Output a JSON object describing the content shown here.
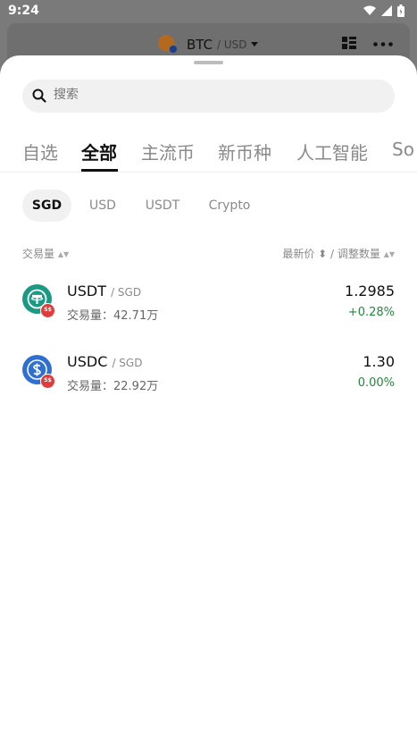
{
  "status_bar": {
    "time": "9:24"
  },
  "header": {
    "base": "BTC",
    "quote": "/ USD"
  },
  "search": {
    "placeholder": "搜索"
  },
  "tabs": [
    {
      "label": "自选"
    },
    {
      "label": "全部"
    },
    {
      "label": "主流币"
    },
    {
      "label": "新币种"
    },
    {
      "label": "人工智能"
    },
    {
      "label": "So"
    }
  ],
  "currencies": [
    {
      "label": "SGD"
    },
    {
      "label": "USD"
    },
    {
      "label": "USDT"
    },
    {
      "label": "Crypto"
    }
  ],
  "columns": {
    "volume": "交易量",
    "price_change": "最新价 ⬍ / 调整数量"
  },
  "rows": [
    {
      "symbol": "USDT",
      "quote": "/ SGD",
      "volume": "交易量：42.71万",
      "price": "1.2985",
      "change": "+0.28%",
      "badge": "S$",
      "color": "#1a9a83"
    },
    {
      "symbol": "USDC",
      "quote": "/ SGD",
      "volume": "交易量：22.92万",
      "price": "1.30",
      "change": "0.00%",
      "badge": "S$",
      "color": "#2f6fd1"
    }
  ]
}
